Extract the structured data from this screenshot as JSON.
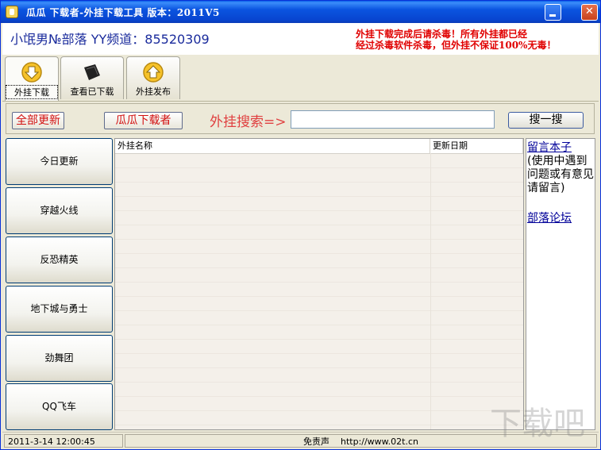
{
  "window": {
    "title": "瓜瓜  下载者-外挂下载工具  版本：2011V5",
    "minimize_label": "minimize",
    "close_label": "close"
  },
  "header": {
    "channel_text": "小氓男№部落  YY频道：85520309",
    "warning_line1": "外挂下载完成后请杀毒！所有外挂都已经",
    "warning_line2": "经过杀毒软件杀毒，但外挂不保证100%无毒！"
  },
  "tabs": [
    {
      "label": "外挂下载",
      "icon": "down-arrow-icon",
      "active": true
    },
    {
      "label": "查看已下载",
      "icon": "folder-icon",
      "active": false
    },
    {
      "label": "外挂发布",
      "icon": "up-arrow-icon",
      "active": false
    }
  ],
  "search": {
    "update_all_label": "全部更新",
    "downloader_label": "瓜瓜下载者",
    "search_label": "外挂搜索=>",
    "input_value": "",
    "search_button_label": "搜一搜"
  },
  "games": [
    {
      "label": "今日更新"
    },
    {
      "label": "穿越火线"
    },
    {
      "label": "反恐精英"
    },
    {
      "label": "地下城与勇士"
    },
    {
      "label": "劲舞团"
    },
    {
      "label": "QQ飞车"
    }
  ],
  "table": {
    "columns": [
      "外挂名称",
      "更新日期"
    ],
    "rows": []
  },
  "side": {
    "guestbook_link": "留言本子",
    "guestbook_note": "(使用中遇到问题或有意见请留言)",
    "forum_link": "部落论坛"
  },
  "status": {
    "datetime": "2011-3-14 12:00:45",
    "disclaimer": "免责声",
    "url": "http://www.02t.cn"
  },
  "watermark": {
    "text": "下载吧"
  },
  "colors": {
    "title_bar": "#0a54e0",
    "warning": "#e00000",
    "channel": "#1a2b9c",
    "link": "#000099"
  }
}
